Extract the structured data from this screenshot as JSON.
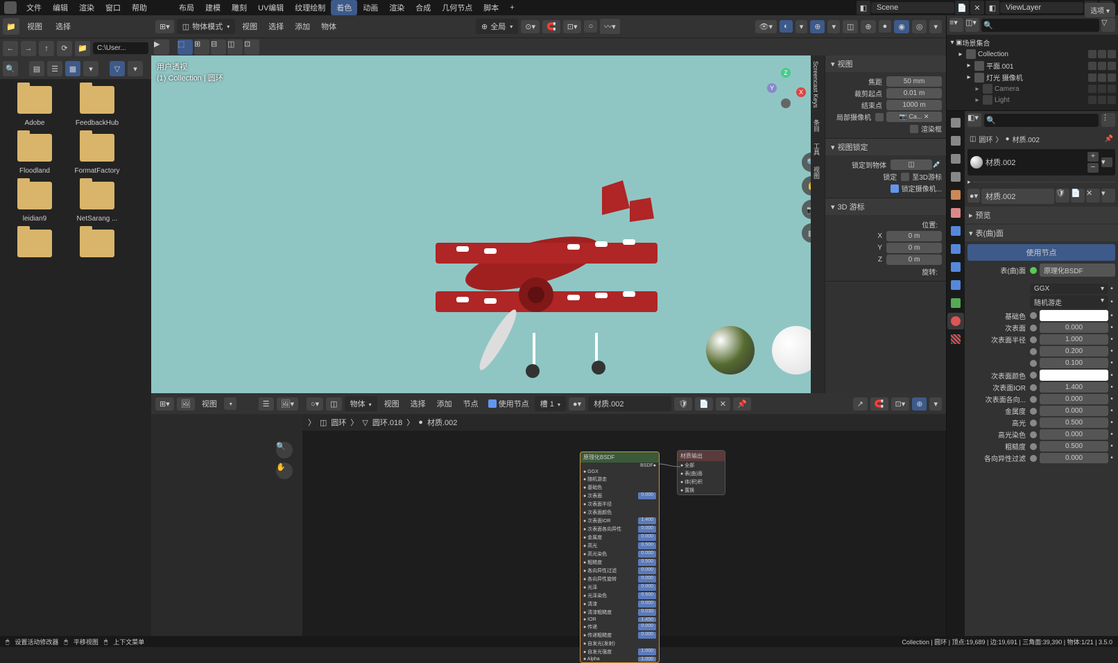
{
  "topbar": {
    "menus_left": [
      "文件",
      "编辑",
      "渲染",
      "窗口",
      "帮助"
    ],
    "workspaces": [
      "布局",
      "建模",
      "雕刻",
      "UV编辑",
      "纹理绘制",
      "着色",
      "动画",
      "渲染",
      "合成",
      "几何节点",
      "脚本"
    ],
    "active_workspace": "着色",
    "add": "+",
    "scene_label": "Scene",
    "viewlayer_label": "ViewLayer"
  },
  "filebrowser": {
    "view": "视图",
    "select": "选择",
    "path": "C:\\User...",
    "folders": [
      "Adobe",
      "FeedbackHub",
      "Floodland",
      "FormatFactory",
      "leidian9",
      "NetSarang ..."
    ]
  },
  "viewport": {
    "mode": "物体模式",
    "menus": [
      "视图",
      "选择",
      "添加",
      "物体"
    ],
    "orient": "全局",
    "overlay_line1": "用户透视",
    "overlay_line2": "(1) Collection | 圆环",
    "options_btn": "选项",
    "npanel": {
      "view": {
        "title": "视图",
        "focal_lbl": "焦距",
        "focal": "50 mm",
        "clip_start_lbl": "裁剪起点",
        "clip_start": "0.01 m",
        "clip_end_lbl": "结束点",
        "clip_end": "1000 m",
        "local_cam_lbl": "局部摄像机",
        "local_cam": "Ca...",
        "render_border": "渲染框"
      },
      "view_lock": {
        "title": "视图锁定",
        "lock_to_obj": "锁定到物体",
        "lock_lbl": "锁定",
        "to_cursor": "至3D游标",
        "lock_cam": "锁定摄像机..."
      },
      "cursor": {
        "title": "3D 游标",
        "pos_lbl": "位置:",
        "x": "0 m",
        "y": "0 m",
        "z": "0 m",
        "rot_lbl": "旋转:"
      }
    },
    "tabs": [
      "Screencast Keys",
      "条目",
      "工具",
      "视图"
    ]
  },
  "nodeeditor": {
    "type": "物体",
    "menus": [
      "视图",
      "选择",
      "添加",
      "节点"
    ],
    "use_nodes_lbl": "使用节点",
    "slot": "槽 1",
    "material": "材质.002",
    "view_menu": "视图",
    "breadcrumb": [
      "圆环",
      "圆环.018",
      "材质.002"
    ],
    "node1_title": "原理化BSDF",
    "node1_out": "BSDF",
    "node1_rows": [
      {
        "l": "GGX",
        "v": ""
      },
      {
        "l": "随机游走",
        "v": ""
      },
      {
        "l": "基础色",
        "v": ""
      },
      {
        "l": "次表面",
        "v": "0.000"
      },
      {
        "l": "次表面半径",
        "v": ""
      },
      {
        "l": "次表面颜色",
        "v": ""
      },
      {
        "l": "次表面IOR",
        "v": "1.400"
      },
      {
        "l": "次表面各向异性",
        "v": "0.000"
      },
      {
        "l": "金属度",
        "v": "0.000"
      },
      {
        "l": "高光",
        "v": "0.500"
      },
      {
        "l": "高光染色",
        "v": "0.000"
      },
      {
        "l": "粗糙度",
        "v": "0.500"
      },
      {
        "l": "各向异性过滤",
        "v": "0.000"
      },
      {
        "l": "各向异性旋转",
        "v": "0.000"
      },
      {
        "l": "光泽",
        "v": "0.000"
      },
      {
        "l": "光泽染色",
        "v": "0.500"
      },
      {
        "l": "清漆",
        "v": "0.000"
      },
      {
        "l": "清漆粗糙度",
        "v": "0.030"
      },
      {
        "l": "IOR",
        "v": "1.450"
      },
      {
        "l": "传递",
        "v": "0.000"
      },
      {
        "l": "传递粗糙度",
        "v": "0.000"
      },
      {
        "l": "自发光(发射)",
        "v": ""
      },
      {
        "l": "自发光强度",
        "v": "1.000"
      },
      {
        "l": "Alpha",
        "v": "1.000"
      }
    ],
    "node2_title": "材质输出",
    "node2_rows": [
      "全部",
      "表(曲)面",
      "体(积)积",
      "置换"
    ]
  },
  "outliner": {
    "title": "场景集合",
    "items": [
      {
        "name": "Collection",
        "indent": 1,
        "icon": "collection",
        "checks": true
      },
      {
        "name": "平面.001",
        "indent": 2,
        "icon": "mesh",
        "checks": true
      },
      {
        "name": "灯光 摄像机",
        "indent": 2,
        "icon": "collection",
        "checks": true
      },
      {
        "name": "Camera",
        "indent": 3,
        "icon": "camera",
        "checks": true,
        "dim": true
      },
      {
        "name": "Light",
        "indent": 3,
        "icon": "light",
        "checks": true,
        "dim": true
      }
    ]
  },
  "properties": {
    "breadcrumb_obj": "圆环",
    "breadcrumb_mat": "材质.002",
    "material_name": "材质.002",
    "material_field": "材质.002",
    "preview": "预览",
    "surface_sec": "表(曲)面",
    "use_nodes": "使用节点",
    "surface_lbl": "表(曲)面",
    "surface_val": "原理化BSDF",
    "dist1": "GGX",
    "dist2": "随机游走",
    "rows": [
      {
        "l": "基础色",
        "type": "color",
        "v": "#ffffff"
      },
      {
        "l": "次表面",
        "type": "num",
        "v": "0.000"
      },
      {
        "l": "次表面半径",
        "type": "num",
        "v": "1.000"
      },
      {
        "l": "",
        "type": "num",
        "v": "0.200"
      },
      {
        "l": "",
        "type": "num",
        "v": "0.100"
      },
      {
        "l": "次表面颜色",
        "type": "color",
        "v": "#ffffff"
      },
      {
        "l": "次表面IOR",
        "type": "num",
        "v": "1.400"
      },
      {
        "l": "次表面各向...",
        "type": "num",
        "v": "0.000"
      },
      {
        "l": "金属度",
        "type": "num",
        "v": "0.000"
      },
      {
        "l": "高光",
        "type": "num",
        "v": "0.500"
      },
      {
        "l": "高光染色",
        "type": "num",
        "v": "0.000"
      },
      {
        "l": "粗糙度",
        "type": "num",
        "v": "0.500"
      },
      {
        "l": "各向异性过滤",
        "type": "num",
        "v": "0.000"
      }
    ]
  },
  "statusbar": {
    "left1": "设置活动修改器",
    "left2": "平移视图",
    "left3": "上下文菜单",
    "right": "Collection | 圆环 | 顶点:19,689 | 边:19,691 | 三角面:39,390 | 物体:1/21 | 3.5.0"
  }
}
